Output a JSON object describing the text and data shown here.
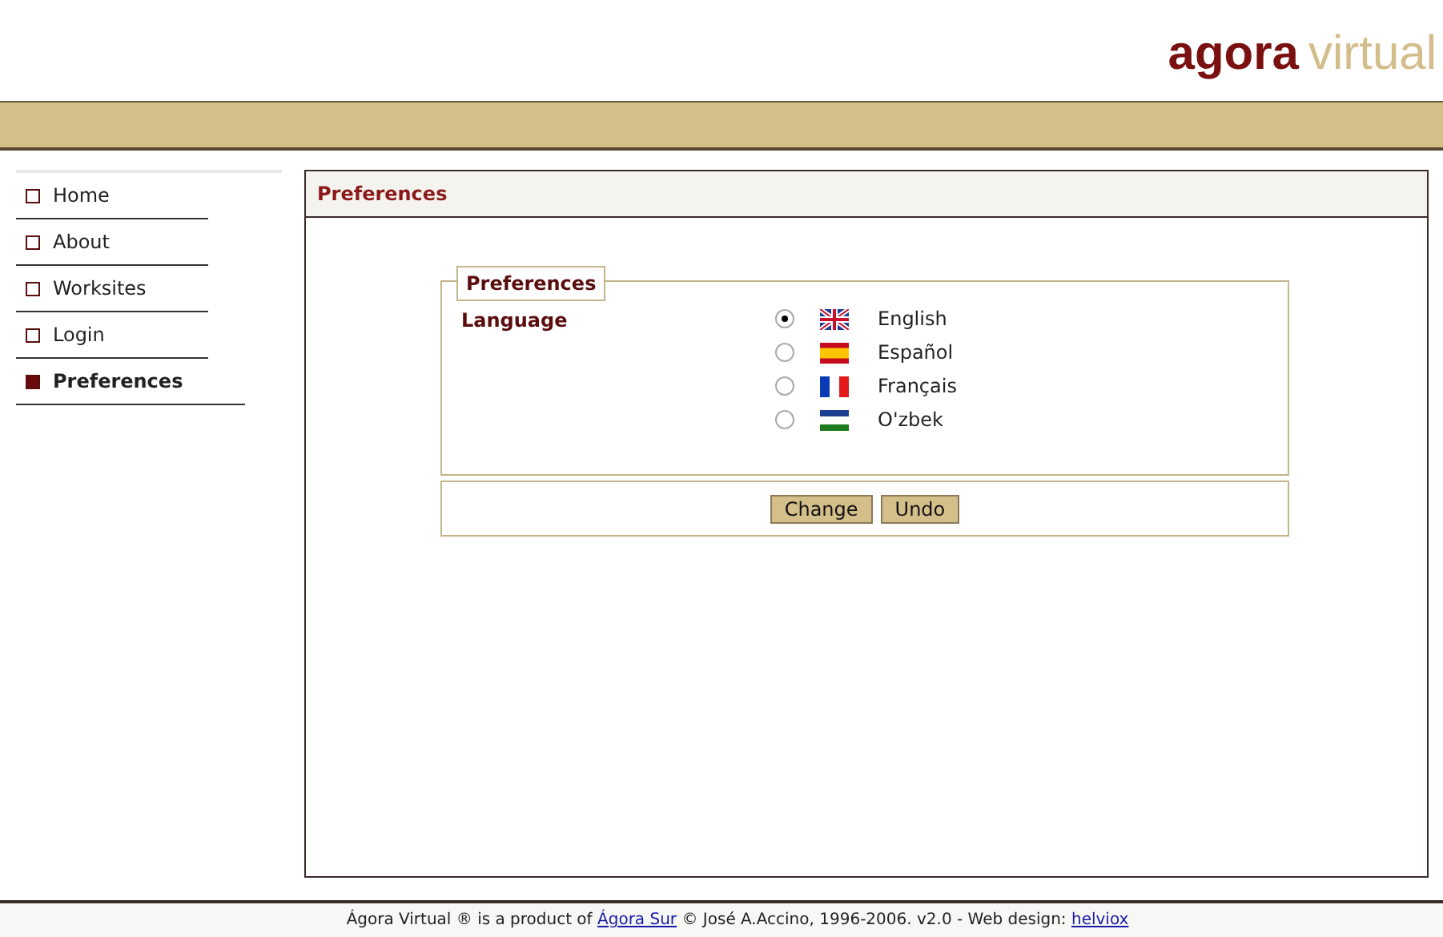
{
  "logo": {
    "first": "agora",
    "second": "virtual"
  },
  "nav": [
    {
      "label": "Home",
      "selected": false
    },
    {
      "label": "About",
      "selected": false
    },
    {
      "label": "Worksites",
      "selected": false
    },
    {
      "label": "Login",
      "selected": false
    },
    {
      "label": "Preferences",
      "selected": true
    }
  ],
  "panel_title": "Preferences",
  "fieldset": {
    "legend": "Preferences",
    "label": "Language",
    "options": [
      {
        "label": "English",
        "kind": "uk",
        "selected": true
      },
      {
        "label": "Español",
        "kind": "es",
        "selected": false
      },
      {
        "label": "Français",
        "kind": "fr",
        "selected": false
      },
      {
        "label": "O'zbek",
        "kind": "uz",
        "selected": false
      }
    ]
  },
  "buttons": [
    "Change",
    "Undo"
  ],
  "footer": {
    "before": "Ágora Virtual ® is a product of",
    "link1": "Ágora Sur",
    "middle": "© José A.Accino, 1996-2006. v2.0 - Web design:",
    "link2": "helviox"
  }
}
